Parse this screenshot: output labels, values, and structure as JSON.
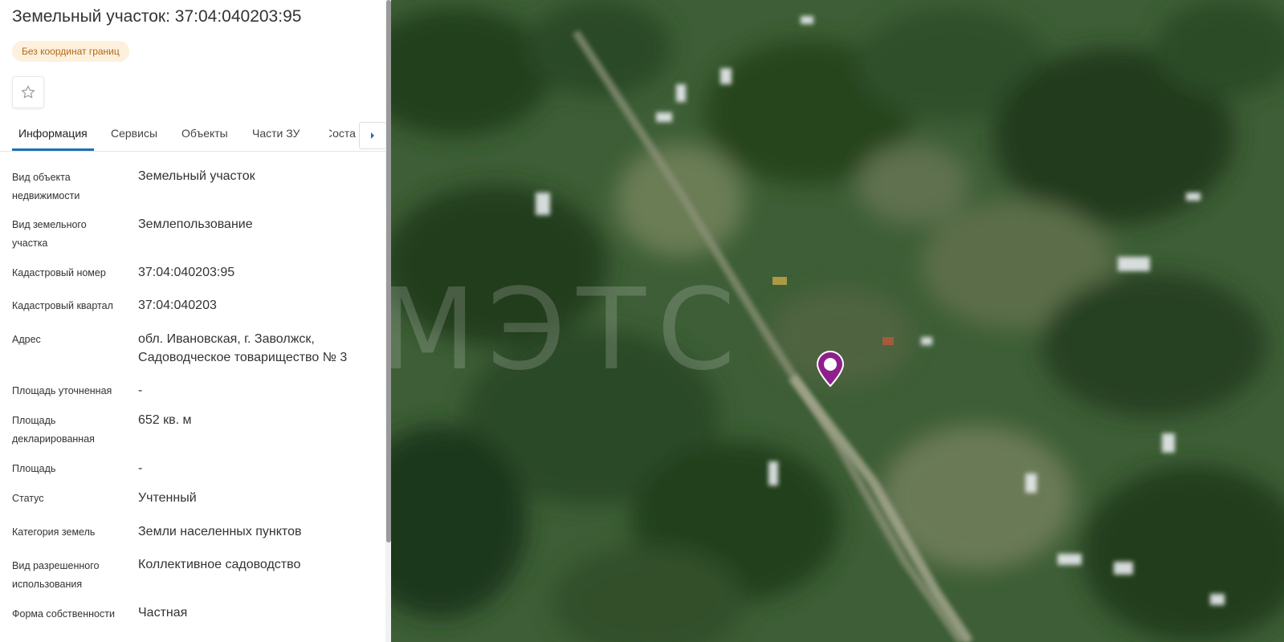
{
  "header": {
    "title": "Земельный участок: 37:04:040203:95",
    "badge": "Без координат границ"
  },
  "tabs": [
    {
      "label": "Информация",
      "active": true
    },
    {
      "label": "Сервисы"
    },
    {
      "label": "Объекты"
    },
    {
      "label": "Части ЗУ"
    },
    {
      "label": "Соста"
    }
  ],
  "properties": [
    {
      "label": "Вид объекта недвижимости",
      "value": "Земельный участок"
    },
    {
      "label": "Вид земельного участка",
      "value": "Землепользование"
    },
    {
      "label": "Кадастровый номер",
      "value": "37:04:040203:95"
    },
    {
      "label": "Кадастровый квартал",
      "value": "37:04:040203"
    },
    {
      "label": "Адрес",
      "value": "обл. Ивановская, г. Заволжск, Садоводческое товарищество № 3"
    },
    {
      "label": "Площадь уточненная",
      "value": "-"
    },
    {
      "label": "Площадь декларированная",
      "value": "652 кв. м"
    },
    {
      "label": "Площадь",
      "value": "-"
    },
    {
      "label": "Статус",
      "value": "Учтенный"
    },
    {
      "label": "Категория земель",
      "value": "Земли населенных пунктов"
    },
    {
      "label": "Вид разрешенного использования",
      "value": "Коллективное садоводство"
    },
    {
      "label": "Форма собственности",
      "value": "Частная"
    }
  ],
  "map": {
    "watermark": "МЭТС",
    "marker_color": "#8e1f8c"
  },
  "colors": {
    "accent": "#1d6fb8",
    "badge_bg": "#fdf0dd",
    "badge_text": "#b06a17"
  },
  "icons": [
    "star-icon",
    "chevron-right-icon",
    "map-marker-icon"
  ]
}
